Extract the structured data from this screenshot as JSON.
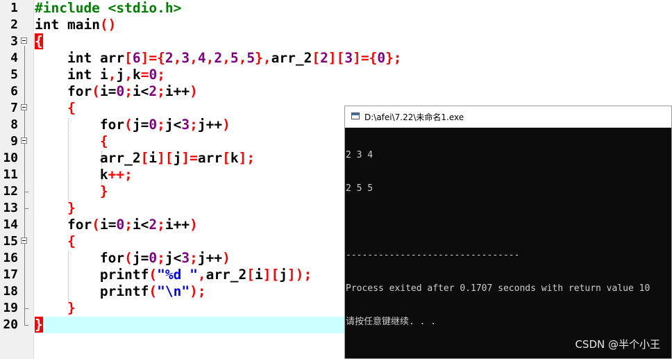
{
  "editor": {
    "lines": [
      {
        "num": "1"
      },
      {
        "num": "2"
      },
      {
        "num": "3"
      },
      {
        "num": "4"
      },
      {
        "num": "5"
      },
      {
        "num": "6"
      },
      {
        "num": "7"
      },
      {
        "num": "8"
      },
      {
        "num": "9"
      },
      {
        "num": "10"
      },
      {
        "num": "11"
      },
      {
        "num": "12"
      },
      {
        "num": "13"
      },
      {
        "num": "14"
      },
      {
        "num": "15"
      },
      {
        "num": "16"
      },
      {
        "num": "17"
      },
      {
        "num": "18"
      },
      {
        "num": "19"
      },
      {
        "num": "20"
      }
    ],
    "code": {
      "l1_include": "#include <stdio.h>",
      "l2_int": "int",
      "l2_main": " main",
      "l2_parens": "()",
      "brace_open": "{",
      "brace_close": "}",
      "l4_int": "int",
      "l4_arr": " arr",
      "l4_lb": "[",
      "l4_6": "6",
      "l4_rb_eq_lb": "]={",
      "l4_2a": "2",
      "c": ",",
      "l4_3": "3",
      "l4_4": "4",
      "l4_2b": "2",
      "l4_5a": "5",
      "l4_5b": "5",
      "l4_close": "},",
      "l4_arr2": "arr_2",
      "l4_lb2": "[",
      "l4_2c": "2",
      "l4_mid": "][",
      "l4_3b": "3",
      "l4_eq": "]={",
      "l4_0": "0",
      "l4_end": "};",
      "l5_int": "int",
      "l5_i": " i",
      "l5_j": "j",
      "l5_k": "k",
      "l5_eq": "=",
      "l5_0": "0",
      "semi": ";",
      "for_kw": "for",
      "lp": "(",
      "rp": ")",
      "i_eq": "i=",
      "j_eq": "j=",
      "zero": "0",
      "i_lt": "i<",
      "j_lt": "j<",
      "two": "2",
      "three": "3",
      "i_inc": "i++",
      "j_inc": "j++",
      "l10_a": "arr_2",
      "l10_b": "[",
      "l10_i": "i",
      "l10_c": "][",
      "l10_j": "j",
      "l10_d": "]=",
      "l10_arr": "arr",
      "l10_e": "[",
      "l10_k": "k",
      "l10_f": "];",
      "l11_k": "k",
      "l11_inc": "++;",
      "printf": "printf",
      "l17_str": "\"%d \"",
      "l17_arr2": "arr_2",
      "l17_tail": "]);",
      "l18_str": "\"\\n\"",
      "l18_tail": ");"
    }
  },
  "console": {
    "title": "D:\\afei\\7.22\\未命名1.exe",
    "output_lines": [
      "2 3 4",
      "2 5 5",
      "",
      "--------------------------------",
      "Process exited after 0.1707 seconds with return value 10",
      "请按任意键继续. . ."
    ]
  },
  "watermark": "CSDN @半个小王"
}
